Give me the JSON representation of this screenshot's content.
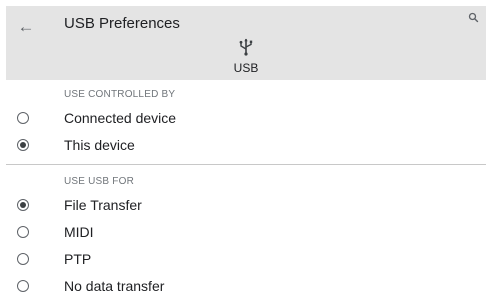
{
  "header": {
    "back_icon": "arrow-left-icon",
    "title": "USB Preferences",
    "search_icon": "search-icon",
    "usb_icon": "usb-icon",
    "usb_label": "USB"
  },
  "controlled_by": {
    "heading": "USE CONTROLLED BY",
    "options": [
      {
        "label": "Connected device",
        "selected": false
      },
      {
        "label": "This device",
        "selected": true
      }
    ]
  },
  "use_usb_for": {
    "heading": "USE USB FOR",
    "options": [
      {
        "label": "File Transfer",
        "selected": true
      },
      {
        "label": "MIDI",
        "selected": false
      },
      {
        "label": "PTP",
        "selected": false
      },
      {
        "label": "No data transfer",
        "selected": false
      }
    ]
  },
  "colors": {
    "appbar_bg": "#e4e4e4",
    "text": "#202124",
    "secondary_text": "#70757a"
  }
}
